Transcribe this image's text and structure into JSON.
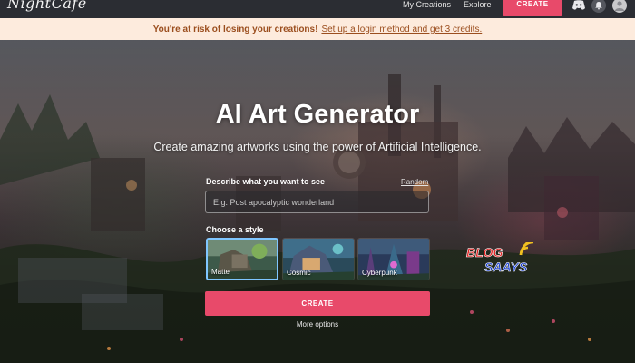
{
  "nav": {
    "logo_text": "NightCafe",
    "links": [
      "My Creations",
      "Explore"
    ],
    "create_label": "CREATE",
    "icons": [
      "discord-icon",
      "bell-icon",
      "avatar"
    ]
  },
  "banner": {
    "warning": "You're at risk of losing your creations!",
    "link": "Set up a login method and get 3 credits."
  },
  "hero": {
    "title": "AI Art Generator",
    "subtitle": "Create amazing artworks using the power of Artificial Intelligence.",
    "prompt_label": "Describe what you want to see",
    "random_label": "Random",
    "prompt_placeholder": "E.g. Post apocalyptic wonderland",
    "prompt_value": "",
    "style_label": "Choose a style",
    "styles": [
      {
        "name": "Matte",
        "selected": true
      },
      {
        "name": "Cosmic",
        "selected": false
      },
      {
        "name": "Cyberpunk",
        "selected": false
      }
    ],
    "create_label": "CREATE",
    "more_options": "More options"
  },
  "watermark": {
    "line1": "BLOG",
    "line2": "SAAYS"
  },
  "colors": {
    "accent": "#e84a6a",
    "banner_bg": "#fdebdd",
    "banner_text": "#9b4e1e",
    "topbar_bg": "#2b2d33",
    "selected_border": "#7fc6ff"
  }
}
